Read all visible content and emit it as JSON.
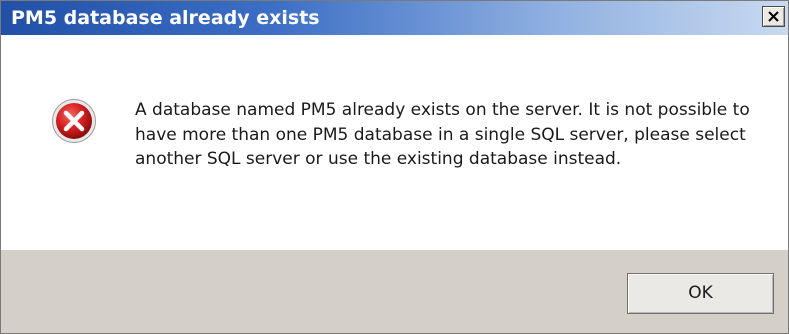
{
  "window": {
    "title": "PM5 database already exists",
    "close_icon": "close-icon"
  },
  "message": {
    "icon": "error-icon",
    "text": "A database named PM5 already exists on the server. It is not possible to have more than one PM5 database in a single SQL server, please select another SQL server or use the existing database instead."
  },
  "buttons": {
    "ok_label": "OK"
  },
  "colors": {
    "titlebar_start": "#2150a8",
    "titlebar_end": "#c9d9f0",
    "error_red": "#d6201f",
    "button_bar": "#d4d0c8"
  }
}
